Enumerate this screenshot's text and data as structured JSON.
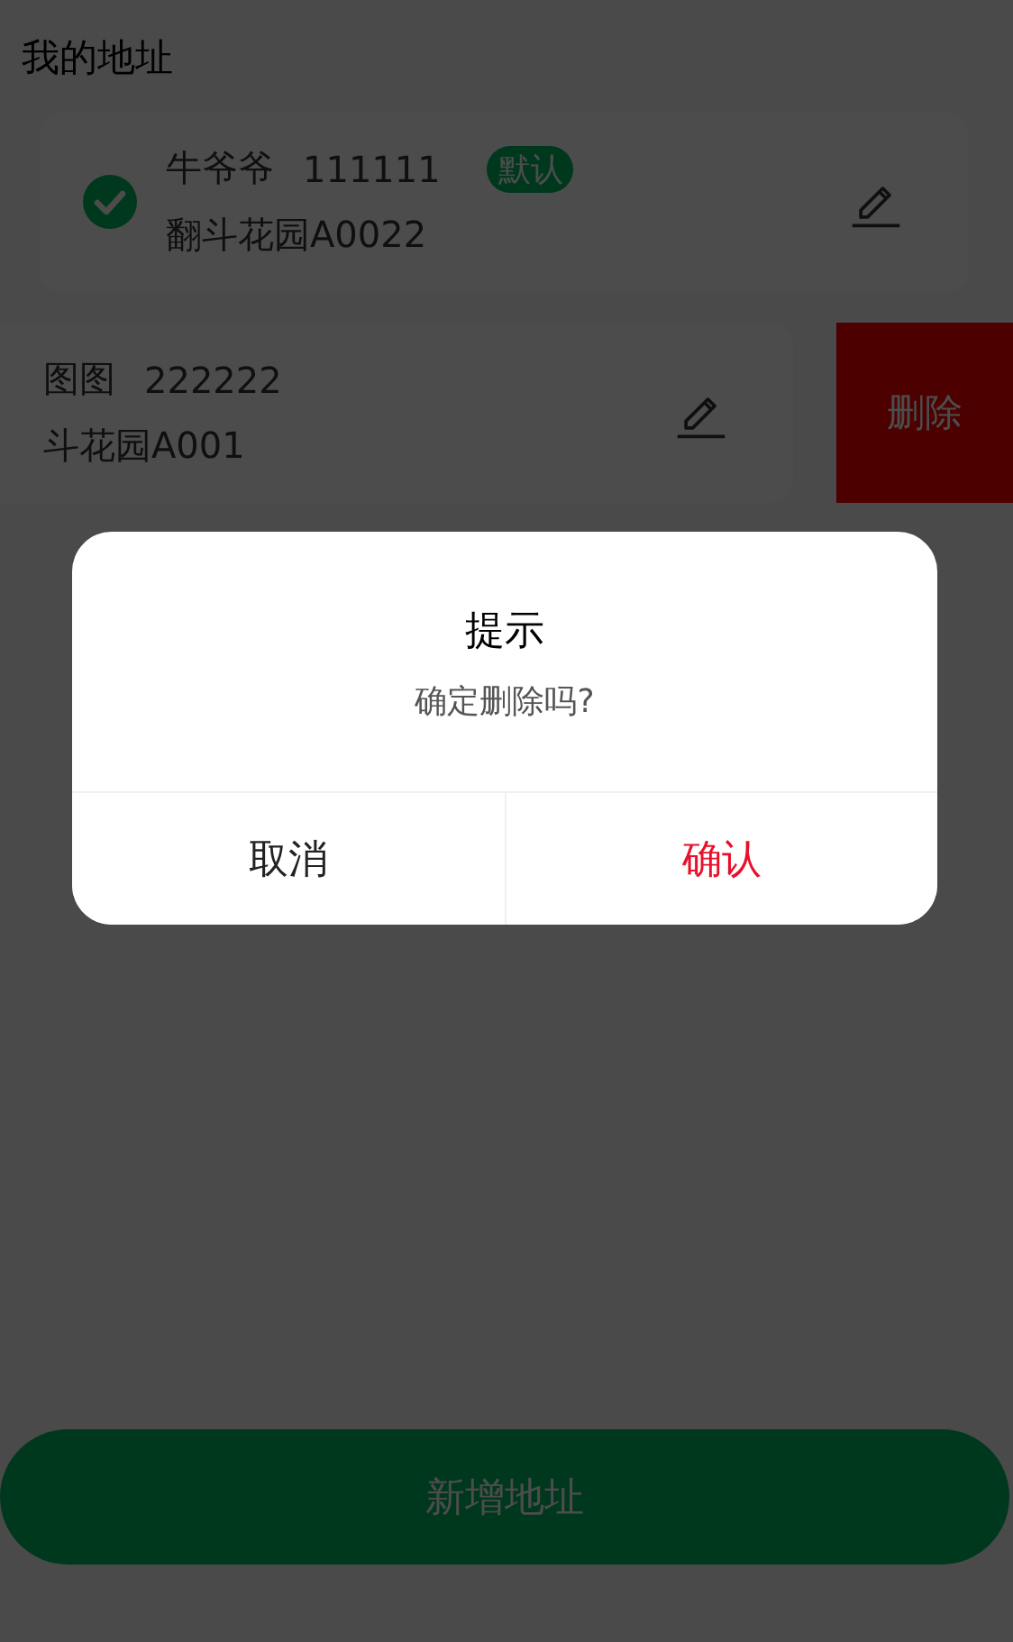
{
  "page": {
    "title": "我的地址"
  },
  "addresses": [
    {
      "name": "牛爷爷",
      "phone": "111111",
      "badge": "默认",
      "address": "翻斗花园A0022",
      "selected": true,
      "swiped": false
    },
    {
      "name": "图图",
      "phone": "222222",
      "address": "斗花园A001",
      "selected": false,
      "swiped": true,
      "action": "删除"
    }
  ],
  "dialog": {
    "title": "提示",
    "message": "确定删除吗?",
    "buttons": [
      {
        "label": "取消",
        "kind": "cancel"
      },
      {
        "label": "确认",
        "kind": "confirm"
      }
    ]
  },
  "bottom_button": "新增地址"
}
